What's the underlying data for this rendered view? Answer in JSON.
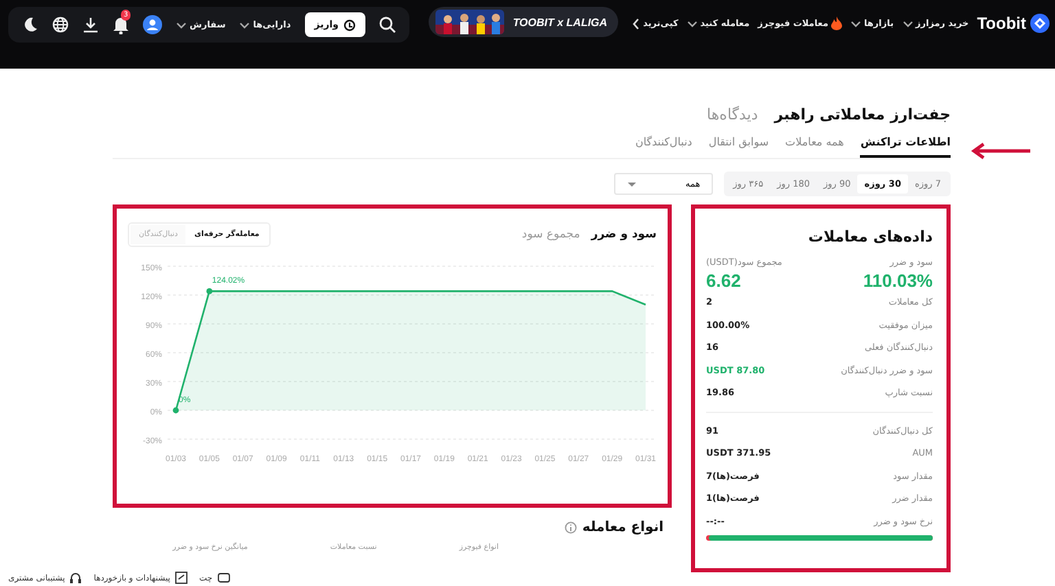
{
  "header": {
    "logo": "Toobit",
    "nav": [
      {
        "label": "خرید رمزارز",
        "kind": "dropdown"
      },
      {
        "label": "بازارها",
        "kind": "dropdown"
      },
      {
        "label": "معاملات فیوچرز",
        "kind": "hot"
      },
      {
        "label": "معامله کنید",
        "kind": "dropdown"
      },
      {
        "label": "کپی‌ترید",
        "kind": "chevron"
      }
    ],
    "banner": {
      "text": "TOOBIT x LALIGA"
    },
    "deposit": "واریز",
    "menus": [
      {
        "label": "دارایی‌ها"
      },
      {
        "label": "سفارش"
      }
    ],
    "notification_badge": "3"
  },
  "title_tabs": [
    {
      "label": "جفت‌ارز معاملاتی راهبر",
      "selected": true
    },
    {
      "label": "دیدگاه‌ها",
      "selected": false
    }
  ],
  "tabs": [
    {
      "label": "اطلاعات تراکنش",
      "selected": true
    },
    {
      "label": "همه معاملات",
      "selected": false
    },
    {
      "label": "سوابق انتقال",
      "selected": false
    },
    {
      "label": "دنبال‌کنندگان",
      "selected": false
    }
  ],
  "periods": [
    {
      "label": "7 روزه",
      "selected": false
    },
    {
      "label": "30 روزه",
      "selected": true
    },
    {
      "label": "90 روز",
      "selected": false
    },
    {
      "label": "180 روز",
      "selected": false
    },
    {
      "label": "۳۶۵ روز",
      "selected": false
    }
  ],
  "filter": {
    "value": "همه"
  },
  "chart_panel": {
    "tabs": [
      {
        "label": "سود و ضرر",
        "selected": true
      },
      {
        "label": "مجموع سود",
        "selected": false
      }
    ],
    "toggle": [
      {
        "label": "معامله‌گر حرفه‌ای",
        "selected": true
      },
      {
        "label": "دنبال‌کنندگان",
        "selected": false
      }
    ],
    "chart_data": {
      "type": "area",
      "grid": true,
      "categories": [
        "01/03",
        "01/05",
        "01/07",
        "01/09",
        "01/11",
        "01/13",
        "01/15",
        "01/17",
        "01/19",
        "01/21",
        "01/23",
        "01/25",
        "01/27",
        "01/29",
        "01/31"
      ],
      "series": [
        {
          "color": "#20b26c",
          "values": [
            0,
            124,
            124,
            124,
            124,
            124,
            124,
            124,
            124,
            124,
            124,
            124,
            124,
            124,
            110
          ]
        }
      ],
      "ylim": [
        -30,
        150
      ],
      "yticks": [
        {
          "value": 150,
          "label": "150%"
        },
        {
          "value": 120,
          "label": "120%"
        },
        {
          "value": 90,
          "label": "90%"
        },
        {
          "value": 60,
          "label": "60%"
        },
        {
          "value": 30,
          "label": "30%"
        },
        {
          "value": 0,
          "label": "0%"
        },
        {
          "value": -30,
          "label": "-30%"
        }
      ],
      "annotations": [
        {
          "x": "01/03",
          "y": 0,
          "text": "0%"
        },
        {
          "x": "01/05",
          "y": 124,
          "text": "124.02%"
        }
      ]
    }
  },
  "stats": {
    "title": "داده‌های معاملات",
    "headline": [
      {
        "label": "سود و ضرر",
        "value": "110.03%"
      },
      {
        "label": "مجموع سود(USDT)",
        "value": "6.62"
      }
    ],
    "groups": [
      [
        {
          "label": "کل معاملات",
          "value": "2"
        },
        {
          "label": "میزان موفقیت",
          "value": "100.00%"
        },
        {
          "label": "دنبال‌کنندگان فعلی",
          "value": "16"
        },
        {
          "label": "سود و ضرر دنبال‌کنندگان",
          "value": "87.80 USDT",
          "color": "#20b26c"
        },
        {
          "label": "نسبت شارپ",
          "value": "19.86"
        }
      ],
      [
        {
          "label": "کل دنبال‌کنندگان",
          "value": "91"
        },
        {
          "label": "AUM",
          "value": "371.95 USDT"
        },
        {
          "label": "مقدار سود",
          "value": "فرصت(ها)7"
        },
        {
          "label": "مقدار ضرر",
          "value": "فرصت(ها)1"
        },
        {
          "label": "نرخ سود و ضرر",
          "value": "--:--"
        }
      ]
    ],
    "ratio": {
      "level": 0.985
    }
  },
  "trade_types": {
    "title": "انواع معامله",
    "columns": [
      "انواع فیوچرز",
      "نسبت معاملات",
      "میانگین نرخ سود و ضرر"
    ]
  },
  "support": [
    {
      "label": "چت",
      "kind": "chat"
    },
    {
      "label": "پیشنهادات و بازخوردها",
      "kind": "feedback"
    },
    {
      "label": "پشتیبانی مشتری",
      "kind": "headset"
    }
  ]
}
